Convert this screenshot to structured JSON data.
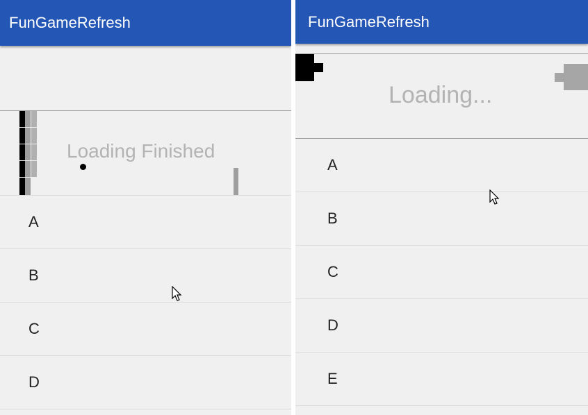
{
  "colors": {
    "app_bar": "#2456b5",
    "background": "#f0f0f0",
    "loading_text": "#b3b3b3",
    "paddle_dark": "#000000",
    "paddle_light": "#9e9e9e"
  },
  "left_screen": {
    "title": "FunGameRefresh",
    "status_text": "Loading Finished",
    "list_items": [
      "A",
      "B",
      "C",
      "D"
    ]
  },
  "right_screen": {
    "title": "FunGameRefresh",
    "status_text": "Loading...",
    "list_items": [
      "A",
      "B",
      "C",
      "D",
      "E"
    ]
  }
}
